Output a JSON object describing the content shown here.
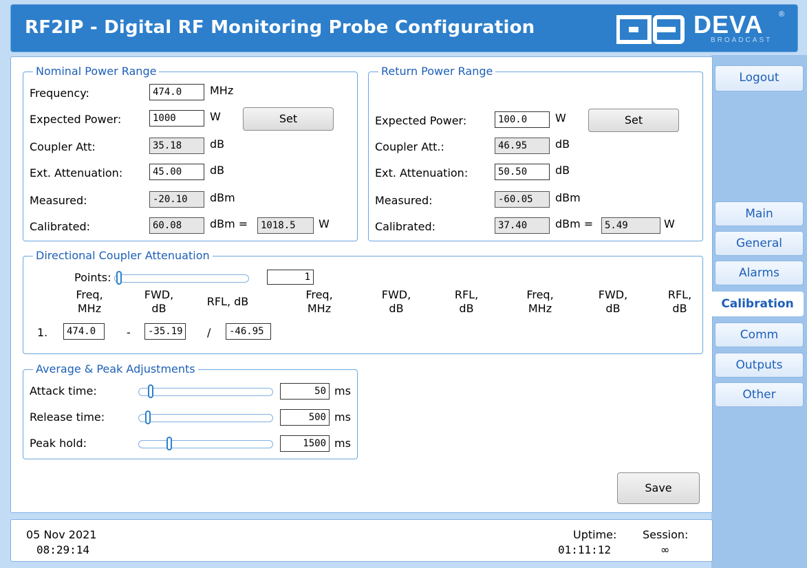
{
  "header": {
    "title": "RF2IP - Digital RF Monitoring Probe Configuration",
    "logo_text": "DEVA",
    "logo_sub": "BROADCAST",
    "logo_reg": "®"
  },
  "nominal": {
    "legend": "Nominal Power Range",
    "frequency": {
      "label": "Frequency:",
      "value": "474.0",
      "unit": "MHz"
    },
    "expected_power": {
      "label": "Expected Power:",
      "value": "1000",
      "unit": "W"
    },
    "coupler_att": {
      "label": "Coupler Att:",
      "value": "35.18",
      "unit": "dB"
    },
    "ext_att": {
      "label": "Ext. Attenuation:",
      "value": "45.00",
      "unit": "dB"
    },
    "measured": {
      "label": "Measured:",
      "value": "-20.10",
      "unit": "dBm"
    },
    "calibrated": {
      "label": "Calibrated:",
      "value": "60.08",
      "unit": "dBm =",
      "watts": "1018.5",
      "watts_unit": "W"
    },
    "set_label": "Set"
  },
  "return": {
    "legend": "Return Power Range",
    "expected_power": {
      "label": "Expected Power:",
      "value": "100.0",
      "unit": "W"
    },
    "coupler_att": {
      "label": "Coupler Att.:",
      "value": "46.95",
      "unit": "dB"
    },
    "ext_att": {
      "label": "Ext. Attenuation:",
      "value": "50.50",
      "unit": "dB"
    },
    "measured": {
      "label": "Measured:",
      "value": "-60.05",
      "unit": "dBm"
    },
    "calibrated": {
      "label": "Calibrated:",
      "value": "37.40",
      "unit": "dBm =",
      "watts": "5.49",
      "watts_unit": "W"
    },
    "set_label": "Set"
  },
  "coupler": {
    "legend": "Directional Coupler Attenuation",
    "points_label": "Points:",
    "points_value": "1",
    "headers": [
      [
        "Freq,",
        "MHz"
      ],
      [
        "FWD,",
        "dB"
      ],
      [
        "RFL, dB",
        ""
      ],
      [
        "Freq,",
        "MHz"
      ],
      [
        "FWD,",
        "dB"
      ],
      [
        "RFL,",
        "dB"
      ],
      [
        "Freq,",
        "MHz"
      ],
      [
        "FWD,",
        "dB"
      ],
      [
        "RFL,",
        "dB"
      ]
    ],
    "row1": {
      "index": "1.",
      "freq": "474.0",
      "dash": "-",
      "fwd": "-35.19",
      "slash": "/",
      "rfl": "-46.95"
    }
  },
  "avgpeak": {
    "legend": "Average & Peak Adjustments",
    "attack": {
      "label": "Attack time:",
      "value": "50",
      "unit": "ms",
      "level": 0.05
    },
    "release": {
      "label": "Release time:",
      "value": "500",
      "unit": "ms",
      "level": 0.03
    },
    "peak": {
      "label": "Peak hold:",
      "value": "1500",
      "unit": "ms",
      "level": 0.2
    }
  },
  "save_label": "Save",
  "footer": {
    "date": "05 Nov 2021",
    "time": "08:29:14",
    "uptime_label": "Uptime:",
    "uptime": "01:11:12",
    "session_label": "Session:",
    "session": "∞"
  },
  "sidebar": {
    "logout": "Logout",
    "items": [
      "Main",
      "General",
      "Alarms",
      "Calibration",
      "Comm",
      "Outputs",
      "Other"
    ],
    "active": "Calibration"
  },
  "colors": {
    "header_bg": "#2d7fcb",
    "accent": "#1d5fb8",
    "page_bg": "#c3dcf5",
    "sidebar_bg": "#9ec4ec"
  }
}
